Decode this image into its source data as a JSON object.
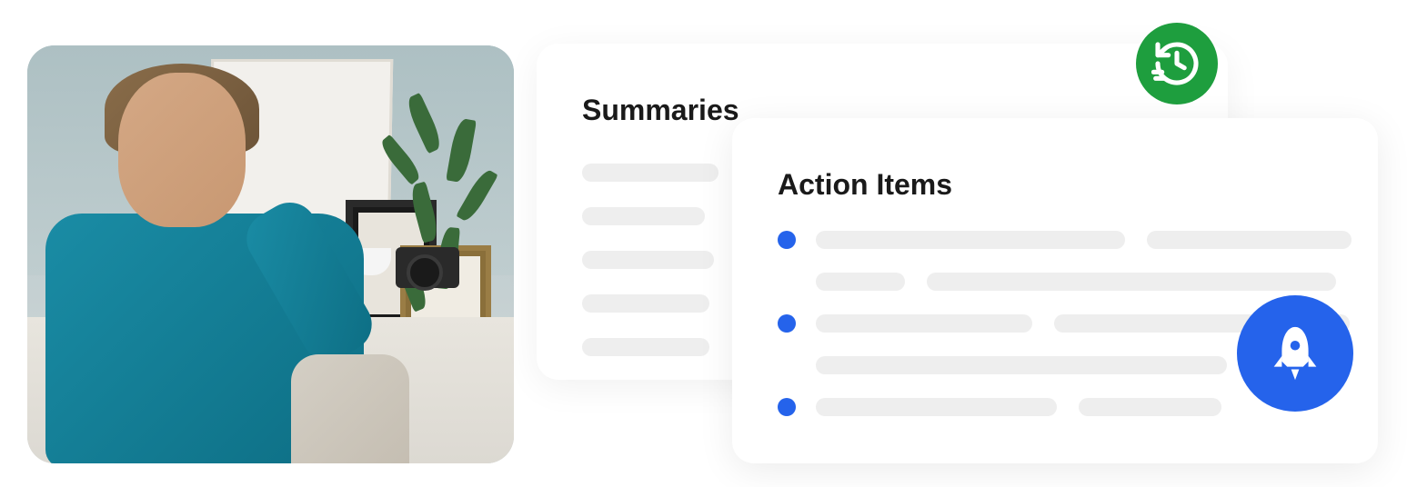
{
  "summaries": {
    "title": "Summaries"
  },
  "actionItems": {
    "title": "Action Items"
  },
  "badges": {
    "history": "history-icon",
    "rocket": "rocket-icon"
  },
  "colors": {
    "accent_blue": "#2563eb",
    "accent_green": "#1e9e3e",
    "placeholder": "#eeeeee"
  }
}
